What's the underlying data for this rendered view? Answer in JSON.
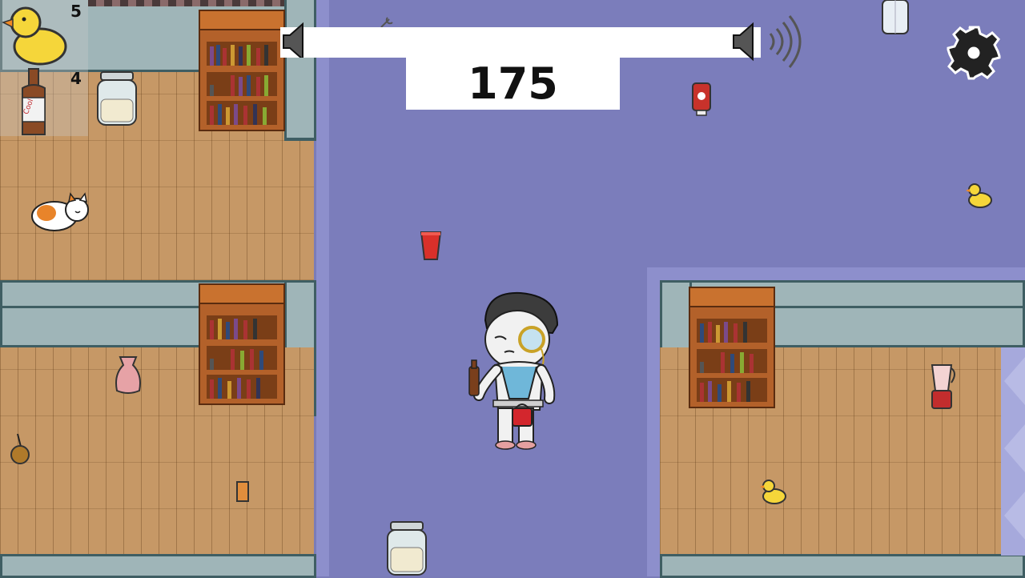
{
  "hud": {
    "inventory": [
      {
        "icon": "rubber-duck-icon",
        "count": "5"
      },
      {
        "icon": "cool-bottle-icon",
        "count": "4",
        "label": "Cool"
      }
    ],
    "score": "175",
    "volume": {
      "level": 1.0
    },
    "settings_icon": "gear-icon"
  },
  "colors": {
    "carpet": "#7b7dbb",
    "wood": "#c69866",
    "wall": "#9fb5b8",
    "bookcase": "#b3612a",
    "duck": "#f5d63a"
  }
}
